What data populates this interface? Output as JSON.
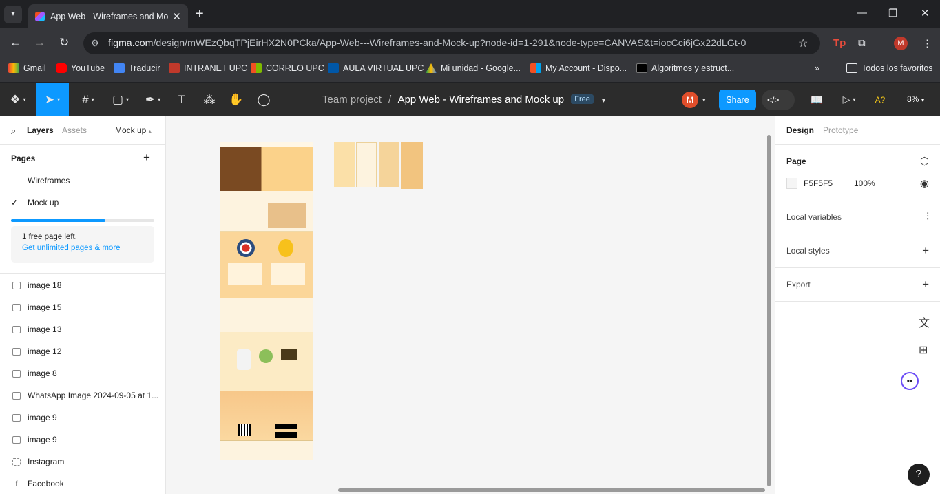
{
  "browser": {
    "tab_title": "App Web - Wireframes and Mo",
    "url_host": "figma.com",
    "url_path": "/design/mWEzQbqTPjEirHX2N0PCka/App-Web---Wireframes-and-Mock-up?node-id=1-291&node-type=CANVAS&t=iocCci6jGx22dLGt-0",
    "profile_initial": "M",
    "bookmarks": [
      "Gmail",
      "YouTube",
      "Traducir",
      "INTRANET UPC",
      "CORREO UPC",
      "AULA VIRTUAL UPC",
      "Mi unidad - Google...",
      "My Account - Dispo...",
      "Algoritmos y estruct..."
    ],
    "all_bookmarks": "Todos los favoritos"
  },
  "toolbar": {
    "team": "Team project",
    "separator": "/",
    "file_name": "App Web - Wireframes and Mock up",
    "plan_badge": "Free",
    "user_initial": "M",
    "share": "Share",
    "zoom": "8%",
    "a11y": "A?"
  },
  "left_panel": {
    "tabs": {
      "layers": "Layers",
      "assets": "Assets"
    },
    "current_page_dropdown": "Mock up",
    "pages_title": "Pages",
    "pages": [
      "Wireframes",
      "Mock up"
    ],
    "selected_page": "Mock up",
    "free_progress": 0.66,
    "free_notice": "1 free page left.",
    "upgrade_link": "Get unlimited pages & more",
    "layers": [
      "image 18",
      "image 15",
      "image 13",
      "image 12",
      "image 8",
      "WhatsApp Image 2024-09-05 at 1...",
      "image 9",
      "image 9",
      "Instagram",
      "Facebook"
    ]
  },
  "right_panel": {
    "tabs": {
      "design": "Design",
      "prototype": "Prototype"
    },
    "page_label": "Page",
    "bg_color": "F5F5F5",
    "bg_opacity": "100%",
    "local_variables": "Local variables",
    "local_styles": "Local styles",
    "export": "Export"
  },
  "colors": {
    "accent": "#0d99ff",
    "toolbar": "#2c2c2c",
    "canvas": "#f5f5f5"
  }
}
